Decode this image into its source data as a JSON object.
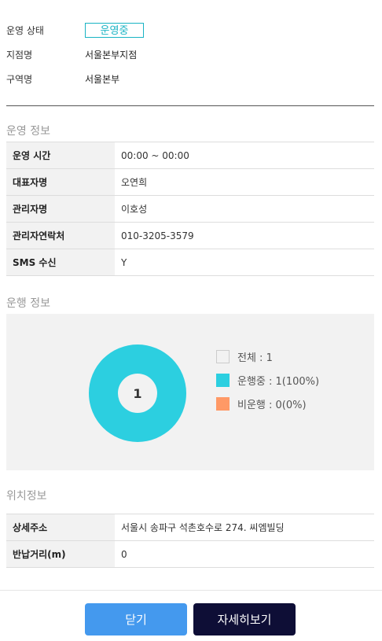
{
  "summary": {
    "status_label": "운영 상태",
    "status_value": "운영중",
    "branch_label": "지점명",
    "branch_value": "서울본부지점",
    "region_label": "구역명",
    "region_value": "서울본부"
  },
  "operation_info": {
    "title": "운영 정보",
    "rows": [
      {
        "label": "운영 시간",
        "value": "00:00 ~ 00:00"
      },
      {
        "label": "대표자명",
        "value": "오연희"
      },
      {
        "label": "관리자명",
        "value": "이호성"
      },
      {
        "label": "관리자연락처",
        "value": "010-3205-3579"
      },
      {
        "label": "SMS 수신",
        "value": "Y"
      }
    ]
  },
  "driving_info": {
    "title": "운행 정보",
    "center_value": "1",
    "legend": [
      {
        "label": "전체 : 1",
        "color": "#ffffff"
      },
      {
        "label": "운행중 : 1(100%)",
        "color": "#2ccfe0"
      },
      {
        "label": "비운행 : 0(0%)",
        "color": "#ff9966"
      }
    ]
  },
  "chart_data": {
    "type": "pie",
    "categories": [
      "운행중",
      "비운행"
    ],
    "values": [
      1,
      0
    ],
    "total": 1
  },
  "location_info": {
    "title": "위치정보",
    "rows": [
      {
        "label": "상세주소",
        "value": "서울시 송파구 석촌호수로 274. 씨엠빌딩"
      },
      {
        "label": "반납거리(m)",
        "value": "0"
      }
    ]
  },
  "buttons": {
    "close": "닫기",
    "detail": "자세히보기"
  }
}
